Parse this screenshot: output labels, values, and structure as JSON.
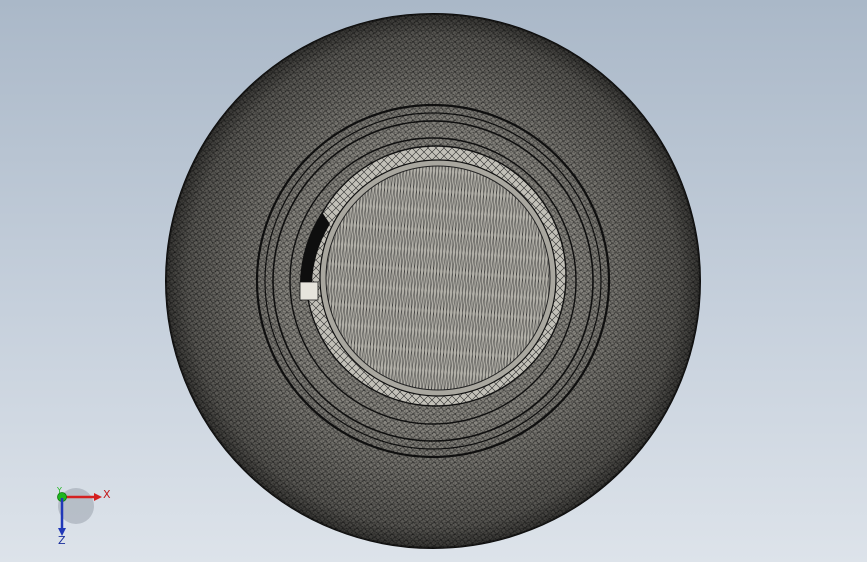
{
  "viewport": {
    "background_top": "#aab8c8",
    "background_bottom": "#dde3ea"
  },
  "model": {
    "display_mode": "wireframe-mesh",
    "mesh_color": "#1a1a1a",
    "face_color": "#8f8d86",
    "inner_face_color": "#b7b5ad"
  },
  "triad": {
    "x_label": "X",
    "y_label": "Y",
    "z_label": "Z",
    "x_color": "#d42020",
    "y_color": "#1fb51f",
    "z_color": "#2038b8"
  }
}
